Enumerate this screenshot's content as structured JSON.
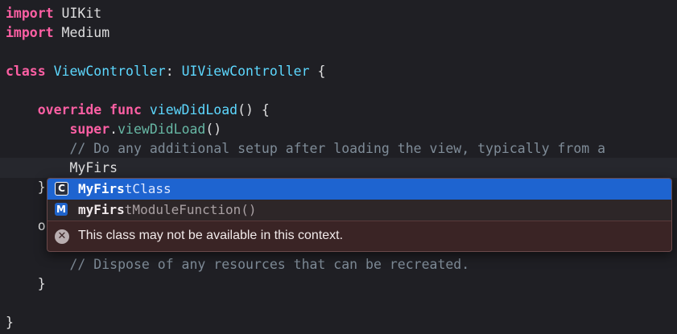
{
  "code": {
    "line1": {
      "kw": "import",
      "rest": " UIKit"
    },
    "line2": {
      "kw": "import",
      "rest": " Medium"
    },
    "line4": {
      "kw": "class",
      "name": " ViewController",
      "sep": ": ",
      "super": "UIViewController",
      "end": " {"
    },
    "line6": {
      "indent": "    ",
      "kw": "override func",
      "name": " viewDidLoad",
      "end": "() {"
    },
    "line7": {
      "indent": "        ",
      "kw": "super",
      "dot": ".",
      "call": "viewDidLoad",
      "end": "()"
    },
    "line8": {
      "indent": "        ",
      "comment": "// Do any additional setup after loading the view, typically from a"
    },
    "line9": {
      "indent": "        ",
      "text": "MyFirs"
    },
    "line10": {
      "text": "    }"
    },
    "line11": {
      "text": "    o"
    },
    "line12": {
      "indent": "        ",
      "comment": "// Dispose of any resources that can be recreated."
    },
    "line13": {
      "text": "    }"
    },
    "line15": {
      "text": "}"
    }
  },
  "autocomplete": {
    "items": [
      {
        "badge": "C",
        "match": "MyFirs",
        "rest": "tClass"
      },
      {
        "badge": "M",
        "match": "myFirs",
        "rest": "tModuleFunction()"
      }
    ],
    "warning": "This class may not be available in this context.",
    "warning_icon": "x-circle-icon"
  },
  "colors": {
    "keyword": "#fc5fa3",
    "type": "#5dd8ff",
    "comment": "#7f8c98",
    "selected": "#1e64d0",
    "popup_bg": "#3a2425"
  }
}
